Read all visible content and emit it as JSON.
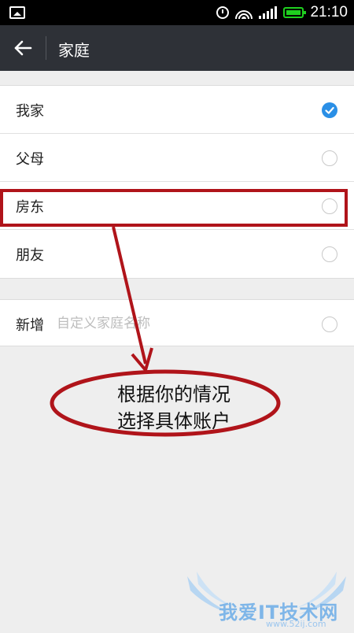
{
  "status_bar": {
    "time": "21:10"
  },
  "header": {
    "title": "家庭"
  },
  "family_list": [
    {
      "label": "我家",
      "checked": true
    },
    {
      "label": "父母",
      "checked": false
    },
    {
      "label": "房东",
      "checked": false
    },
    {
      "label": "朋友",
      "checked": false
    }
  ],
  "add_row": {
    "label": "新增",
    "placeholder": "自定义家庭名称"
  },
  "annotation": {
    "line1": "根据你的情况",
    "line2": "选择具体账户"
  },
  "watermark": {
    "text": "我爱IT技术网",
    "sub": "www.52ij.com"
  },
  "colors": {
    "accent": "#2a8fe6",
    "annotation": "#b0141a",
    "header": "#2e3137"
  }
}
